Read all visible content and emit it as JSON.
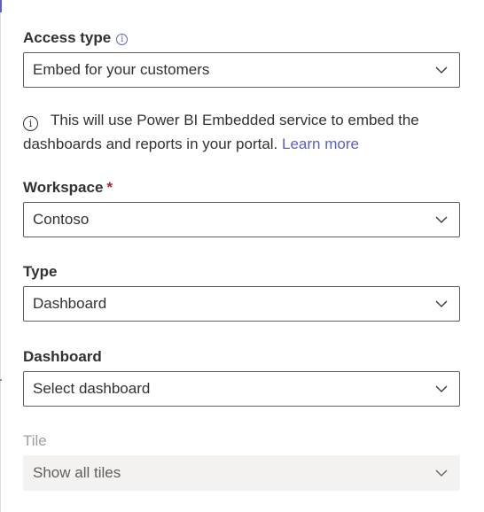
{
  "access_type": {
    "label": "Access type",
    "value": "Embed for your customers",
    "info_icon": "info-icon"
  },
  "note": {
    "text": "This will use Power BI Embedded service to embed the dashboards and reports in your portal. ",
    "link": "Learn more",
    "icon": "info-icon"
  },
  "workspace": {
    "label": "Workspace",
    "required_mark": "*",
    "value": "Contoso"
  },
  "type": {
    "label": "Type",
    "value": "Dashboard"
  },
  "dashboard": {
    "label": "Dashboard",
    "value": "Select dashboard"
  },
  "tile": {
    "label": "Tile",
    "value": "Show all tiles",
    "disabled": true
  },
  "colors": {
    "accent": "#5b5fc7",
    "required": "#a4262c",
    "disabled_bg": "#f3f2f1"
  }
}
